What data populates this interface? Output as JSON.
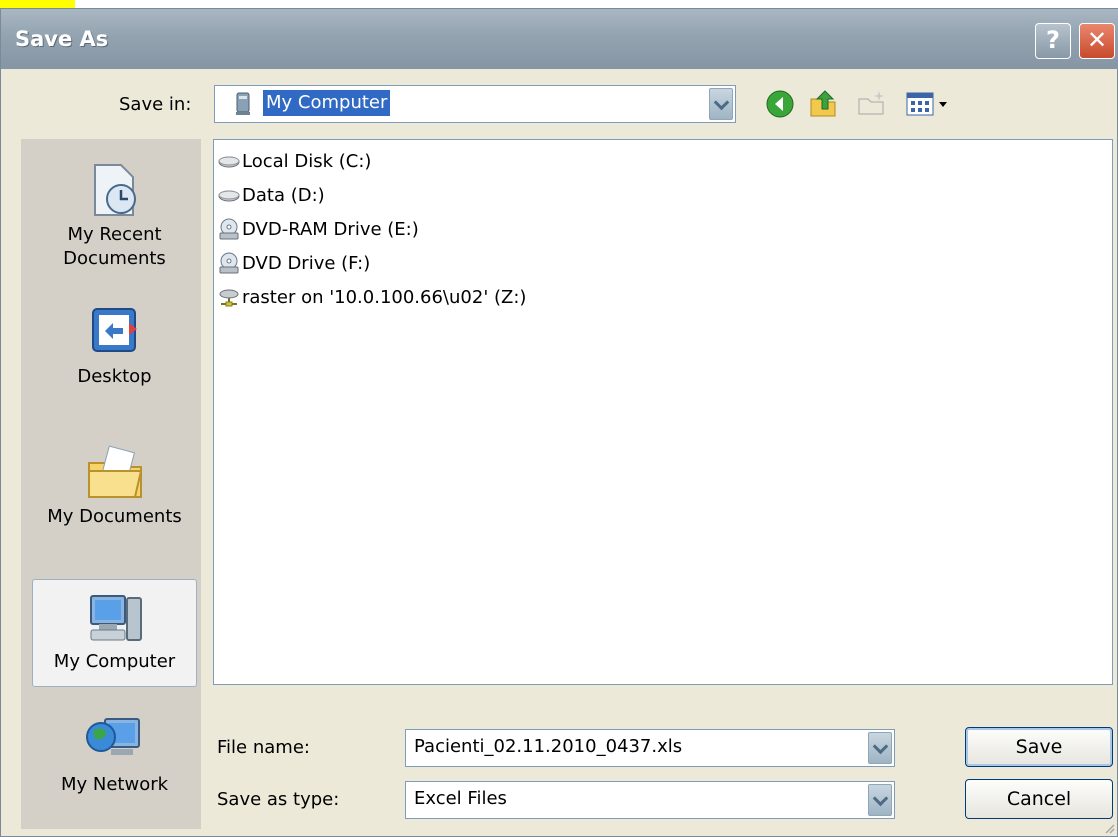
{
  "window": {
    "title": "Save As",
    "help_label": "?",
    "close_label": "✕"
  },
  "toolbar": {
    "save_in_label": "Save in:",
    "save_in_value": "My Computer",
    "icons": [
      "back-icon",
      "up-folder-icon",
      "new-folder-icon",
      "views-menu-icon"
    ]
  },
  "places": [
    {
      "label": "My Recent Documents",
      "line1": "My Recent",
      "line2": "Documents",
      "icon": "recent-documents-icon"
    },
    {
      "label": "Desktop",
      "icon": "desktop-icon"
    },
    {
      "label": "My Documents",
      "icon": "my-documents-icon"
    },
    {
      "label": "My Computer",
      "icon": "my-computer-icon",
      "selected": true
    },
    {
      "label": "My Network",
      "icon": "my-network-icon"
    }
  ],
  "files": [
    {
      "label": "Local Disk (C:)",
      "icon": "hard-drive-icon"
    },
    {
      "label": "Data (D:)",
      "icon": "hard-drive-icon"
    },
    {
      "label": "DVD-RAM Drive (E:)",
      "icon": "dvd-drive-icon"
    },
    {
      "label": "DVD Drive (F:)",
      "icon": "dvd-drive-icon"
    },
    {
      "label": "raster on '10.0.100.66\\u02' (Z:)",
      "icon": "network-drive-icon"
    }
  ],
  "form": {
    "file_name_label": "File name:",
    "file_name_value": "Pacienti_02.11.2010_0437.xls",
    "save_type_label": "Save as type:",
    "save_type_value": "Excel Files"
  },
  "buttons": {
    "save": "Save",
    "cancel": "Cancel"
  },
  "colors": {
    "titlebar": "#93a3b0",
    "selection": "#316ac5",
    "highlight_strip": "#ffff00"
  }
}
